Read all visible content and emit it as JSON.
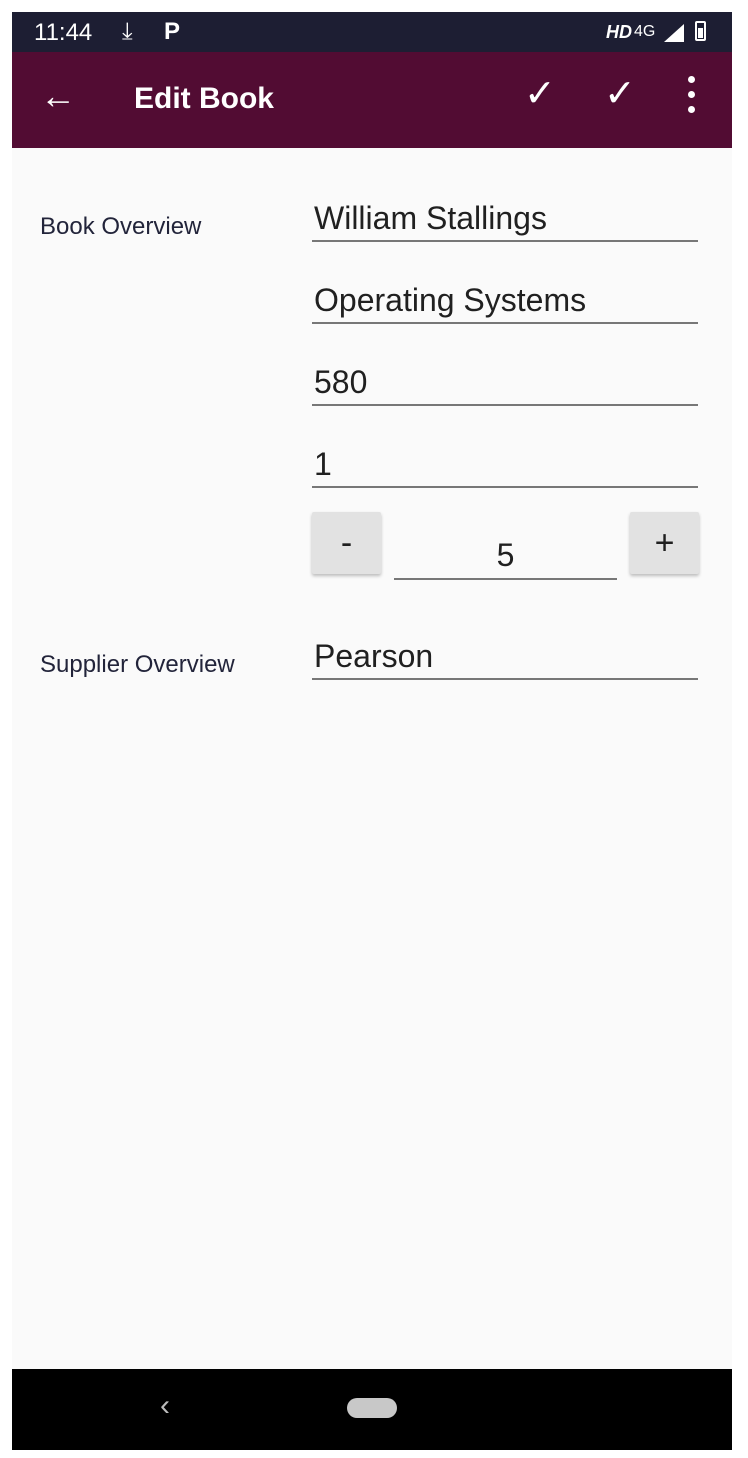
{
  "status_bar": {
    "time": "11:44",
    "download_glyph": "⤓",
    "p_glyph": "P",
    "hd": "HD",
    "network": "4G",
    "icons": [
      "download-icon",
      "p-icon",
      "signal-icon",
      "battery-charging-icon"
    ]
  },
  "app_bar": {
    "title": "Edit Book",
    "back_glyph": "←",
    "check_glyph": "✓",
    "icons": [
      "back-arrow-icon",
      "check-icon",
      "check-icon",
      "overflow-menu-icon"
    ],
    "background": "#520c33"
  },
  "form": {
    "book_overview_label": "Book Overview",
    "author": "William Stallings",
    "title": "Operating Systems",
    "price": "580",
    "field_4": "1",
    "quantity": {
      "minus_label": "-",
      "value": "5",
      "plus_label": "+"
    },
    "supplier_overview_label": "Supplier Overview",
    "supplier": "Pearson"
  },
  "nav_bar": {
    "back_glyph": "‹",
    "icons": [
      "nav-back-icon",
      "nav-home-pill-icon"
    ]
  }
}
